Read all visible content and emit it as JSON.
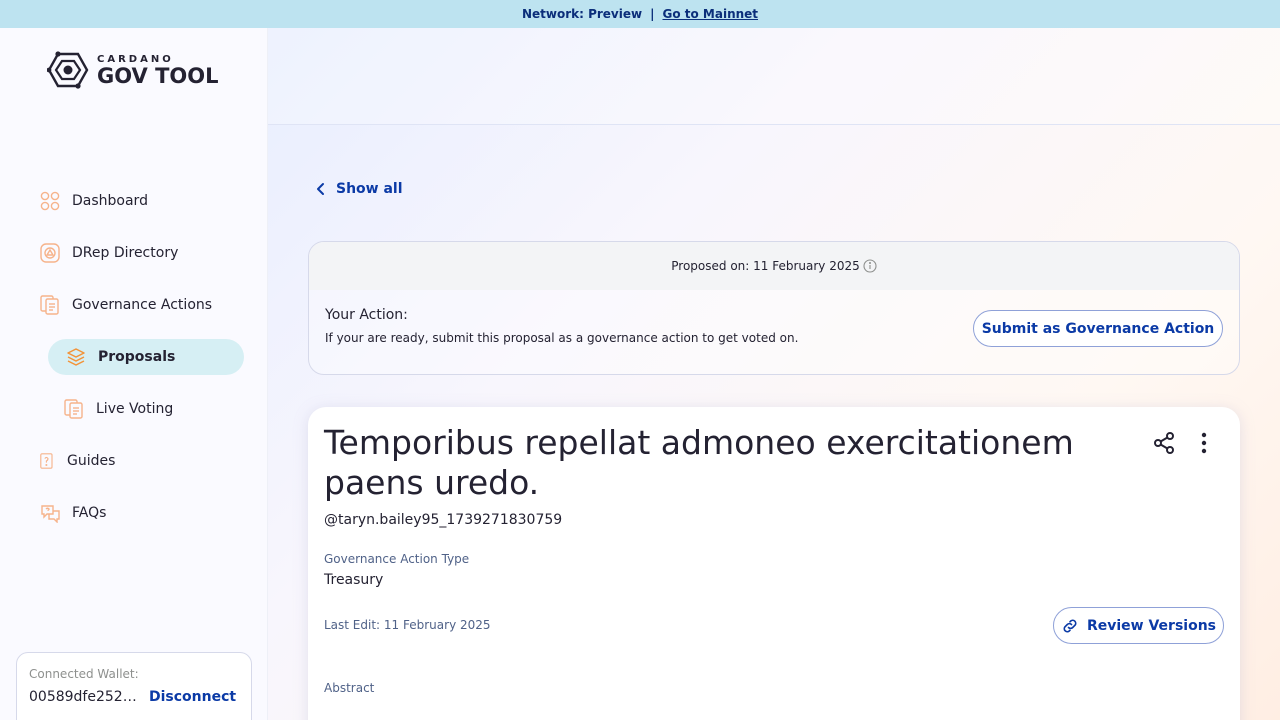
{
  "banner": {
    "network": "Network: Preview",
    "separator": "|",
    "link": "Go to Mainnet"
  },
  "logo": {
    "small": "CARDANO",
    "big": "GOV TOOL"
  },
  "nav": {
    "dashboard": "Dashboard",
    "drep_directory": "DRep Directory",
    "governance_actions": "Governance Actions",
    "proposals": "Proposals",
    "live_voting": "Live Voting",
    "guides": "Guides",
    "faqs": "FAQs"
  },
  "wallet": {
    "label": "Connected Wallet:",
    "address": "00589dfe252a...",
    "disconnect": "Disconnect"
  },
  "back": {
    "label": "Show all"
  },
  "action": {
    "proposed_on": "Proposed on: 11 February 2025",
    "title": "Your Action:",
    "description": "If your are ready, submit this proposal as a governance action to get voted on.",
    "submit_label": "Submit as Governance Action"
  },
  "proposal": {
    "title": "Temporibus repellat admoneo exercitationem paens uredo.",
    "author": "@taryn.bailey95_1739271830759",
    "type_label": "Governance Action Type",
    "type_value": "Treasury",
    "last_edit": "Last Edit: 11 February 2025",
    "review_label": "Review Versions",
    "abstract_label": "Abstract"
  },
  "colors": {
    "banner": "#bde3f0",
    "primary": "#0b3aa6",
    "active_nav": "#d6eff4",
    "icon_accent": "#f6b38b"
  },
  "icons": [
    "grid-icon",
    "drep-icon",
    "documents-icon",
    "layers-icon",
    "guide-icon",
    "faq-icon",
    "chevron-left-icon",
    "info-icon",
    "share-icon",
    "more-vertical-icon",
    "link-icon"
  ]
}
